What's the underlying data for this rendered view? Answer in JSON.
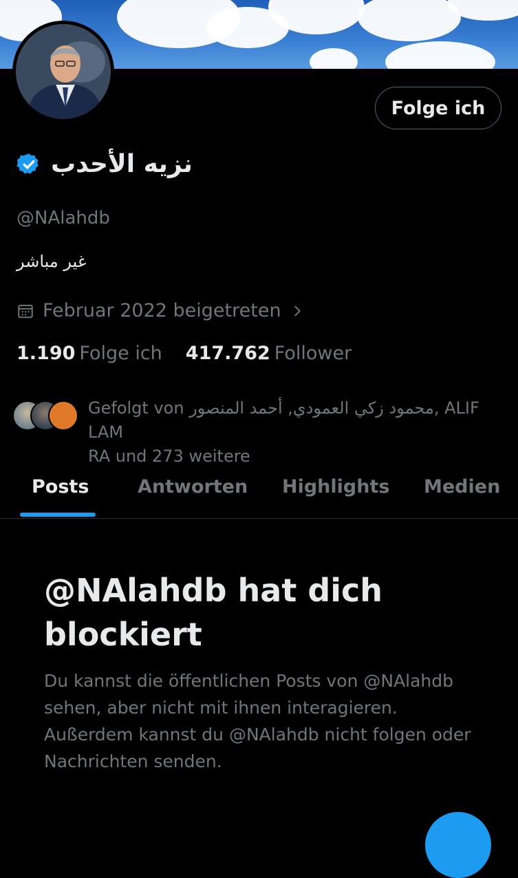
{
  "profile": {
    "display_name": "نزيه الأحدب",
    "handle": "@NAlahdb",
    "bio": "غير مباشر",
    "joined": "Februar 2022 beigetreten",
    "follow_button": "Folge ich",
    "following_count": "1.190",
    "following_label": "Folge ich",
    "followers_count": "417.762",
    "followers_label": "Follower",
    "followed_by_line1": "Gefolgt von محمود زكي العمودي, أحمد المنصور, ALIF LAM",
    "followed_by_line2": "RA und 273 weitere"
  },
  "tabs": [
    "Posts",
    "Antworten",
    "Highlights",
    "Medien"
  ],
  "blocked": {
    "title": "@NAlahdb hat dich blockiert",
    "description": "Du kannst die öffentlichen Posts von @NAlahdb sehen, aber nicht mit ihnen interagieren. Außerdem kannst du @NAlahdb nicht folgen oder Nachrichten senden."
  },
  "icons": {
    "verified": "verified-badge-icon",
    "calendar": "calendar-icon",
    "chevron": "chevron-right-icon"
  },
  "colors": {
    "accent": "#1d9bf0",
    "background": "#000000",
    "muted_text": "#71767b",
    "text": "#e7e9ea"
  }
}
